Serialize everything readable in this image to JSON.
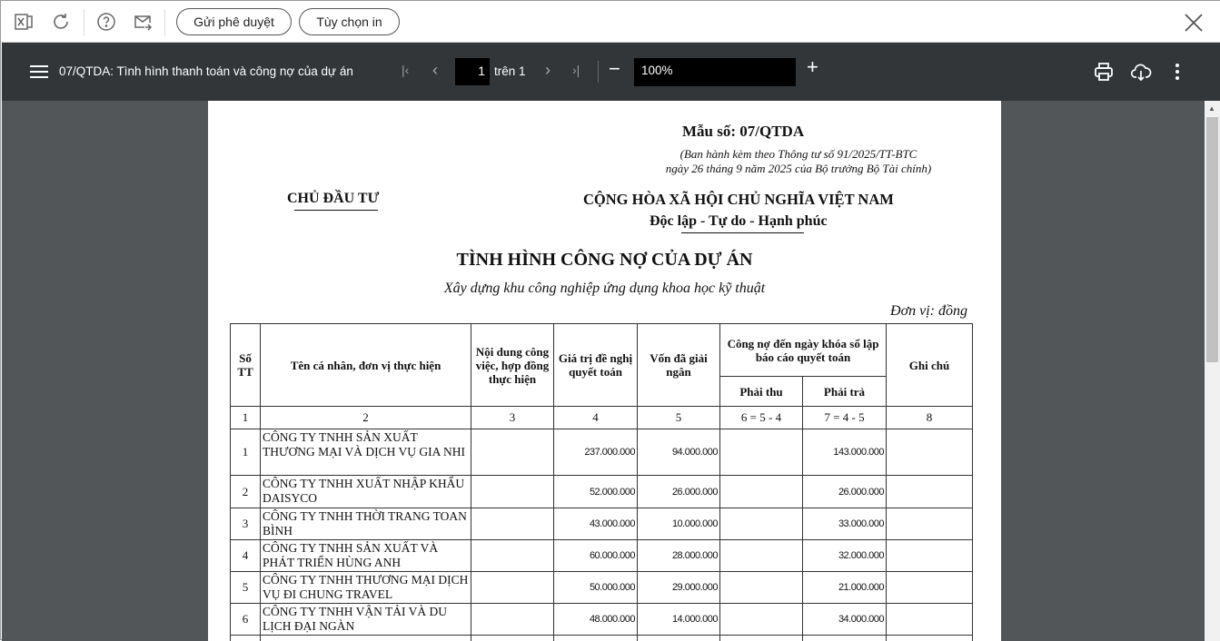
{
  "toolbar": {
    "approve_label": "Gửi phê duyệt",
    "print_options_label": "Tùy chọn in"
  },
  "viewer": {
    "title": "07/QTDA: Tình hình thanh toán và công nợ của dự án",
    "page_current": "1",
    "page_of": "trên 1",
    "zoom": "100%"
  },
  "doc": {
    "form_no": "Mẫu số: 07/QTDA",
    "issued_line1": "(Ban hành kèm theo Thông tư số 91/2025/TT-BTC",
    "issued_line2": "ngày 26 tháng 9 năm 2025 của Bộ trưởng Bộ Tài chính)",
    "investor": "CHỦ ĐẦU TƯ",
    "nation": "CỘNG HÒA XÃ HỘI CHỦ NGHĨA VIỆT NAM",
    "motto": "Độc lập - Tự do - Hạnh phúc",
    "title": "TÌNH HÌNH CÔNG NỢ CỦA DỰ ÁN",
    "project": "Xây dựng khu công nghiệp ứng dụng khoa học kỹ thuật",
    "unit": "Đơn vị: đồng",
    "headers": {
      "stt": "Số TT",
      "name": "Tên cá nhân, đơn vị thực hiện",
      "content": "Nội dung công việc, hợp đồng thực hiện",
      "value": "Giá trị đề nghị quyết toán",
      "disbursed": "Vốn đã giải ngân",
      "debt": "Công nợ đến ngày khóa sổ lập báo cáo quyết toán",
      "receivable": "Phải thu",
      "payable": "Phải trả",
      "note": "Ghi chú"
    },
    "col_numbers": [
      "1",
      "2",
      "3",
      "4",
      "5",
      "6 = 5 - 4",
      "7 = 4 - 5",
      "8"
    ],
    "rows": [
      {
        "stt": "1",
        "name": "CÔNG TY TNHH SẢN XUẤT THƯƠNG MẠI VÀ DỊCH VỤ GIA NHI",
        "value": "237.000.000",
        "disbursed": "94.000.000",
        "payable": "143.000.000"
      },
      {
        "stt": "2",
        "name": "CÔNG TY TNHH XUẤT NHẬP KHẨU DAISYCO",
        "value": "52.000.000",
        "disbursed": "26.000.000",
        "payable": "26.000.000"
      },
      {
        "stt": "3",
        "name": "CÔNG TY TNHH THỜI TRANG TOAN BÌNH",
        "value": "43.000.000",
        "disbursed": "10.000.000",
        "payable": "33.000.000"
      },
      {
        "stt": "4",
        "name": "CÔNG TY TNHH SẢN XUẤT VÀ PHÁT TRIỂN HÙNG ANH",
        "value": "60.000.000",
        "disbursed": "28.000.000",
        "payable": "32.000.000"
      },
      {
        "stt": "5",
        "name": "CÔNG TY TNHH THƯƠNG MẠI DỊCH VỤ ĐI CHUNG TRAVEL",
        "value": "50.000.000",
        "disbursed": "29.000.000",
        "payable": "21.000.000"
      },
      {
        "stt": "6",
        "name": "CÔNG TY TNHH VẬN TẢI VÀ DU LỊCH ĐẠI NGÀN",
        "value": "48.000.000",
        "disbursed": "14.000.000",
        "payable": "34.000.000"
      }
    ]
  }
}
